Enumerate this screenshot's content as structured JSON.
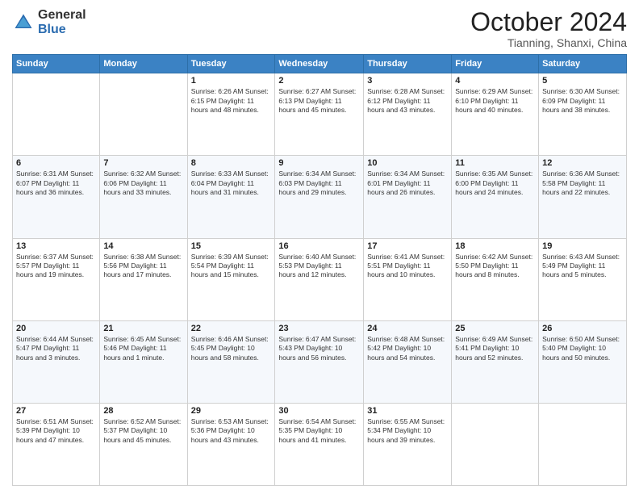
{
  "header": {
    "logo_general": "General",
    "logo_blue": "Blue",
    "month_title": "October 2024",
    "location": "Tianning, Shanxi, China"
  },
  "days_of_week": [
    "Sunday",
    "Monday",
    "Tuesday",
    "Wednesday",
    "Thursday",
    "Friday",
    "Saturday"
  ],
  "weeks": [
    [
      {
        "day": "",
        "content": ""
      },
      {
        "day": "",
        "content": ""
      },
      {
        "day": "1",
        "content": "Sunrise: 6:26 AM\nSunset: 6:15 PM\nDaylight: 11 hours and 48 minutes."
      },
      {
        "day": "2",
        "content": "Sunrise: 6:27 AM\nSunset: 6:13 PM\nDaylight: 11 hours and 45 minutes."
      },
      {
        "day": "3",
        "content": "Sunrise: 6:28 AM\nSunset: 6:12 PM\nDaylight: 11 hours and 43 minutes."
      },
      {
        "day": "4",
        "content": "Sunrise: 6:29 AM\nSunset: 6:10 PM\nDaylight: 11 hours and 40 minutes."
      },
      {
        "day": "5",
        "content": "Sunrise: 6:30 AM\nSunset: 6:09 PM\nDaylight: 11 hours and 38 minutes."
      }
    ],
    [
      {
        "day": "6",
        "content": "Sunrise: 6:31 AM\nSunset: 6:07 PM\nDaylight: 11 hours and 36 minutes."
      },
      {
        "day": "7",
        "content": "Sunrise: 6:32 AM\nSunset: 6:06 PM\nDaylight: 11 hours and 33 minutes."
      },
      {
        "day": "8",
        "content": "Sunrise: 6:33 AM\nSunset: 6:04 PM\nDaylight: 11 hours and 31 minutes."
      },
      {
        "day": "9",
        "content": "Sunrise: 6:34 AM\nSunset: 6:03 PM\nDaylight: 11 hours and 29 minutes."
      },
      {
        "day": "10",
        "content": "Sunrise: 6:34 AM\nSunset: 6:01 PM\nDaylight: 11 hours and 26 minutes."
      },
      {
        "day": "11",
        "content": "Sunrise: 6:35 AM\nSunset: 6:00 PM\nDaylight: 11 hours and 24 minutes."
      },
      {
        "day": "12",
        "content": "Sunrise: 6:36 AM\nSunset: 5:58 PM\nDaylight: 11 hours and 22 minutes."
      }
    ],
    [
      {
        "day": "13",
        "content": "Sunrise: 6:37 AM\nSunset: 5:57 PM\nDaylight: 11 hours and 19 minutes."
      },
      {
        "day": "14",
        "content": "Sunrise: 6:38 AM\nSunset: 5:56 PM\nDaylight: 11 hours and 17 minutes."
      },
      {
        "day": "15",
        "content": "Sunrise: 6:39 AM\nSunset: 5:54 PM\nDaylight: 11 hours and 15 minutes."
      },
      {
        "day": "16",
        "content": "Sunrise: 6:40 AM\nSunset: 5:53 PM\nDaylight: 11 hours and 12 minutes."
      },
      {
        "day": "17",
        "content": "Sunrise: 6:41 AM\nSunset: 5:51 PM\nDaylight: 11 hours and 10 minutes."
      },
      {
        "day": "18",
        "content": "Sunrise: 6:42 AM\nSunset: 5:50 PM\nDaylight: 11 hours and 8 minutes."
      },
      {
        "day": "19",
        "content": "Sunrise: 6:43 AM\nSunset: 5:49 PM\nDaylight: 11 hours and 5 minutes."
      }
    ],
    [
      {
        "day": "20",
        "content": "Sunrise: 6:44 AM\nSunset: 5:47 PM\nDaylight: 11 hours and 3 minutes."
      },
      {
        "day": "21",
        "content": "Sunrise: 6:45 AM\nSunset: 5:46 PM\nDaylight: 11 hours and 1 minute."
      },
      {
        "day": "22",
        "content": "Sunrise: 6:46 AM\nSunset: 5:45 PM\nDaylight: 10 hours and 58 minutes."
      },
      {
        "day": "23",
        "content": "Sunrise: 6:47 AM\nSunset: 5:43 PM\nDaylight: 10 hours and 56 minutes."
      },
      {
        "day": "24",
        "content": "Sunrise: 6:48 AM\nSunset: 5:42 PM\nDaylight: 10 hours and 54 minutes."
      },
      {
        "day": "25",
        "content": "Sunrise: 6:49 AM\nSunset: 5:41 PM\nDaylight: 10 hours and 52 minutes."
      },
      {
        "day": "26",
        "content": "Sunrise: 6:50 AM\nSunset: 5:40 PM\nDaylight: 10 hours and 50 minutes."
      }
    ],
    [
      {
        "day": "27",
        "content": "Sunrise: 6:51 AM\nSunset: 5:39 PM\nDaylight: 10 hours and 47 minutes."
      },
      {
        "day": "28",
        "content": "Sunrise: 6:52 AM\nSunset: 5:37 PM\nDaylight: 10 hours and 45 minutes."
      },
      {
        "day": "29",
        "content": "Sunrise: 6:53 AM\nSunset: 5:36 PM\nDaylight: 10 hours and 43 minutes."
      },
      {
        "day": "30",
        "content": "Sunrise: 6:54 AM\nSunset: 5:35 PM\nDaylight: 10 hours and 41 minutes."
      },
      {
        "day": "31",
        "content": "Sunrise: 6:55 AM\nSunset: 5:34 PM\nDaylight: 10 hours and 39 minutes."
      },
      {
        "day": "",
        "content": ""
      },
      {
        "day": "",
        "content": ""
      }
    ]
  ]
}
